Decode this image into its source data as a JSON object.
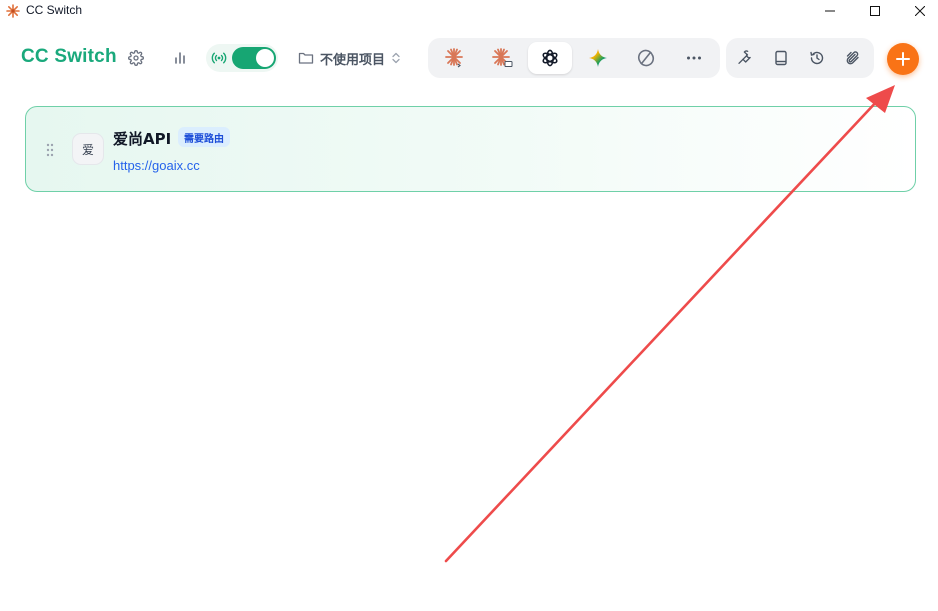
{
  "window": {
    "title": "CC Switch"
  },
  "header": {
    "brand": "CC Switch",
    "proxy_enabled": true,
    "project_label": "不使用项目",
    "apps": [
      {
        "icon": "claude-code-icon",
        "active": false
      },
      {
        "icon": "claude-desktop-icon",
        "active": false
      },
      {
        "icon": "openai-codex-icon",
        "active": true
      },
      {
        "icon": "gemini-icon",
        "active": false
      },
      {
        "icon": "opencode-icon",
        "active": false
      },
      {
        "icon": "more-icon",
        "active": false
      }
    ],
    "tools": [
      "wrench-icon",
      "book-icon",
      "history-icon",
      "paperclip-icon"
    ]
  },
  "providers": [
    {
      "avatar": "爱",
      "name": "爱尚API",
      "badge": "需要路由",
      "url": "https://goaix.cc"
    }
  ],
  "colors": {
    "brand": "#1aa97c",
    "toggle_on": "#17a673",
    "add_button": "#f97316",
    "annotation_arrow": "#ee4b4b",
    "card_border": "#6fd0a8",
    "link": "#2563eb"
  }
}
